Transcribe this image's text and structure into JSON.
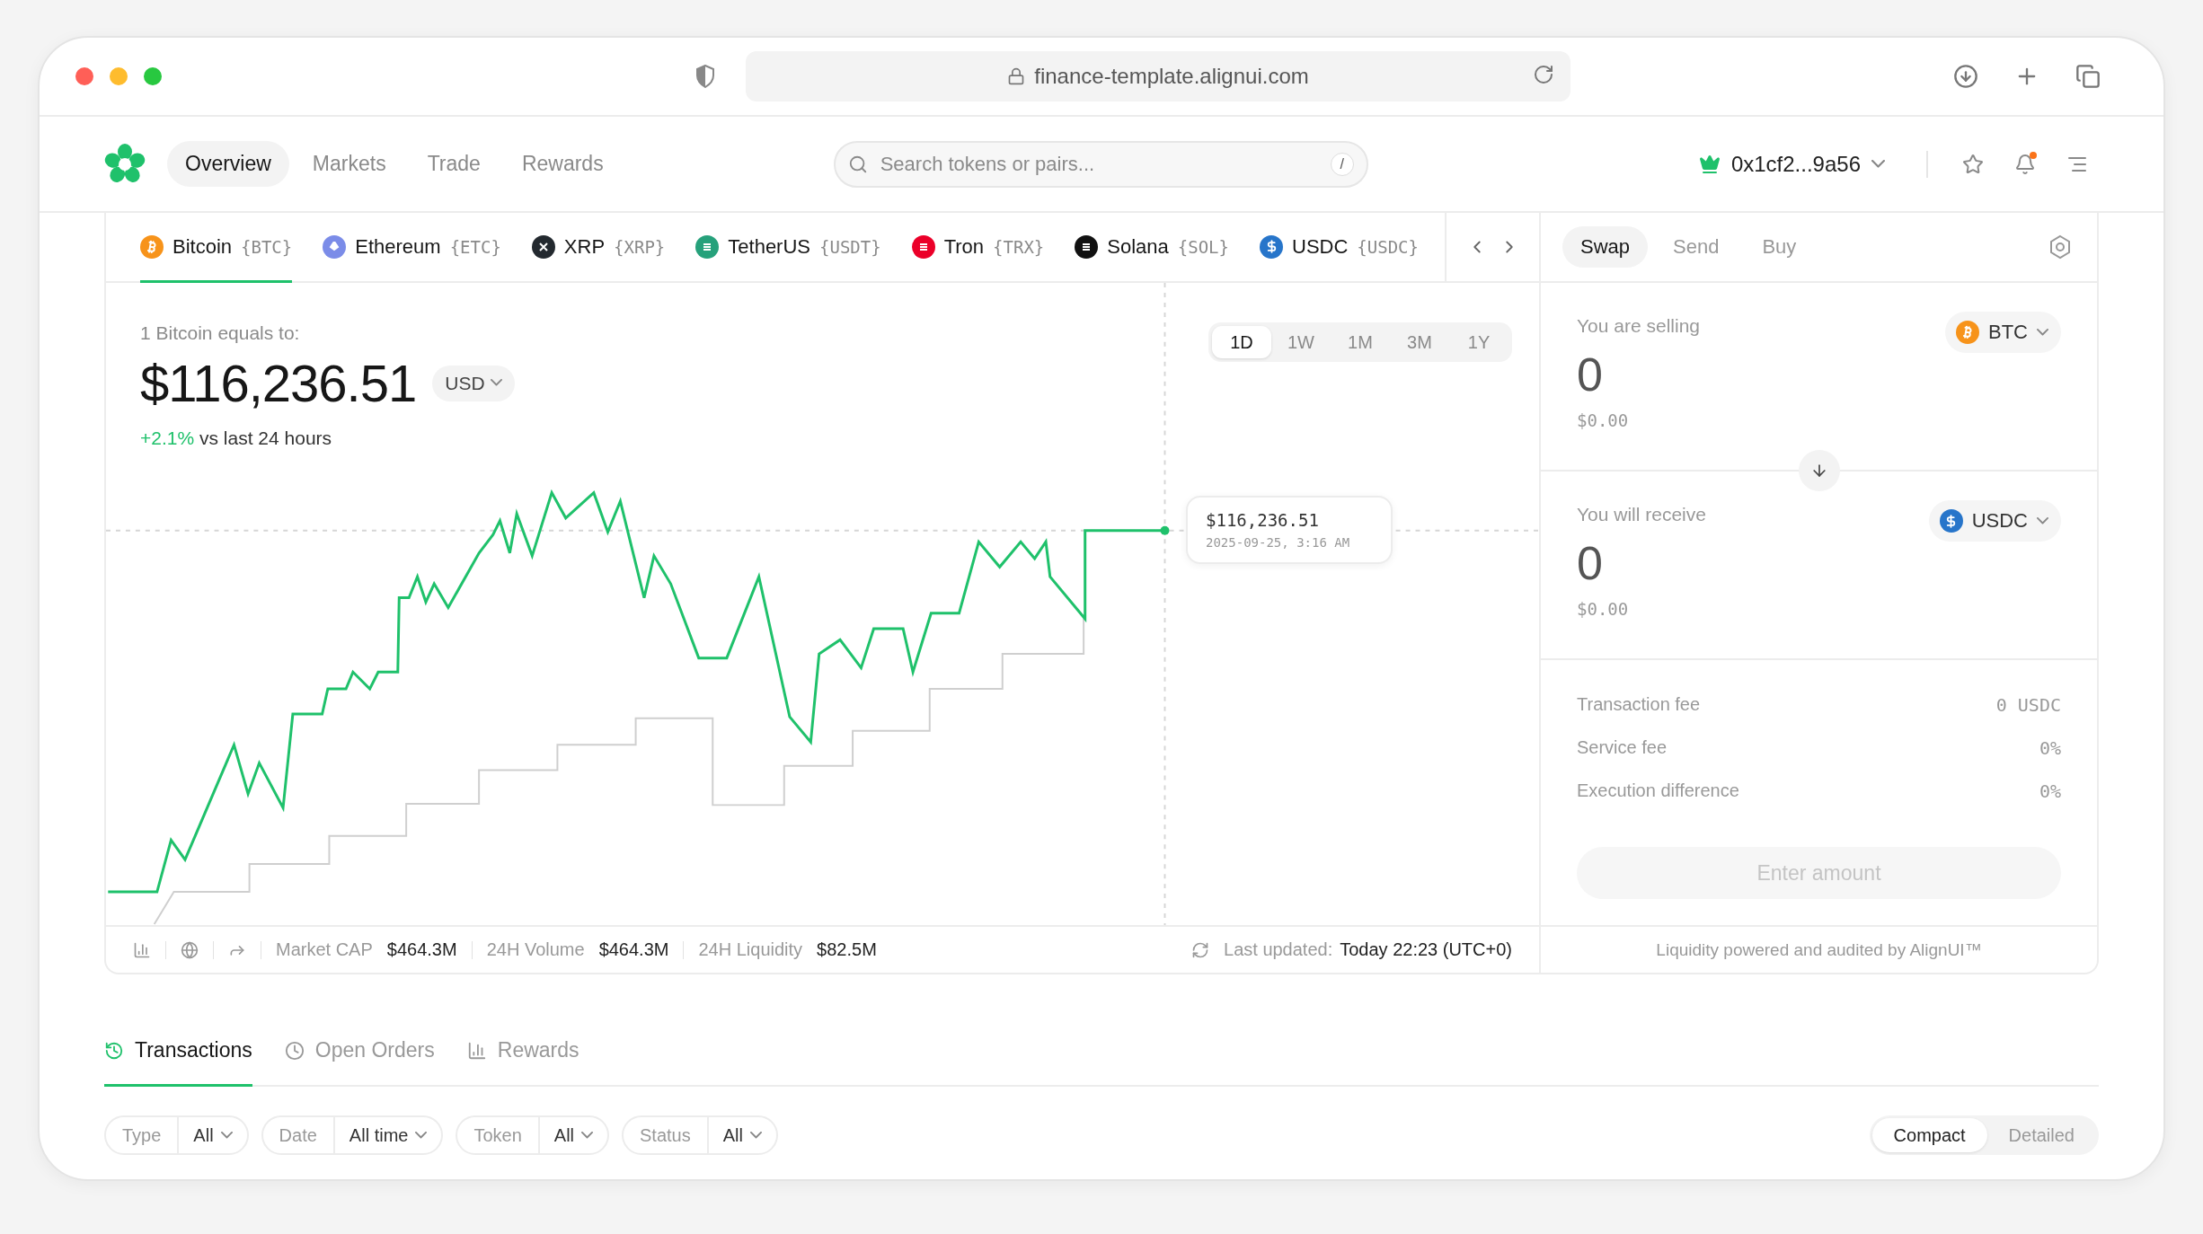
{
  "browser": {
    "url": "finance-template.alignui.com"
  },
  "nav": {
    "items": [
      {
        "label": "Overview",
        "selected": true
      },
      {
        "label": "Markets",
        "selected": false
      },
      {
        "label": "Trade",
        "selected": false
      },
      {
        "label": "Rewards",
        "selected": false
      }
    ],
    "search": {
      "placeholder": "Search tokens or pairs...",
      "shortcut": "/"
    },
    "wallet": "0x1cf2...9a56"
  },
  "tokens": [
    {
      "name": "Bitcoin",
      "symbol": "{BTC}",
      "color": "#f7931a",
      "selected": true
    },
    {
      "name": "Ethereum",
      "symbol": "{ETC}",
      "color": "#7b8ce8",
      "selected": false
    },
    {
      "name": "XRP",
      "symbol": "{XRP}",
      "color": "#23292f",
      "selected": false
    },
    {
      "name": "TetherUS",
      "symbol": "{USDT}",
      "color": "#26a17b",
      "selected": false
    },
    {
      "name": "Tron",
      "symbol": "{TRX}",
      "color": "#eb0029",
      "selected": false
    },
    {
      "name": "Solana",
      "symbol": "{SOL}",
      "color": "#111111",
      "selected": false
    },
    {
      "name": "USDC",
      "symbol": "{USDC}",
      "color": "#2775ca",
      "selected": false
    }
  ],
  "price": {
    "caption": "1 Bitcoin equals to:",
    "value": "$116,236.51",
    "currency": "USD",
    "change": "+2.1%",
    "change_caption": "vs last 24 hours"
  },
  "ranges": [
    {
      "label": "1D",
      "selected": true
    },
    {
      "label": "1W",
      "selected": false
    },
    {
      "label": "1M",
      "selected": false
    },
    {
      "label": "3M",
      "selected": false
    },
    {
      "label": "1Y",
      "selected": false
    }
  ],
  "tooltip": {
    "price": "$116,236.51",
    "time": "2025-09-25, 3:16 AM"
  },
  "stats": [
    {
      "label": "Market CAP",
      "value": "$464.3M"
    },
    {
      "label": "24H Volume",
      "value": "$464.3M"
    },
    {
      "label": "24H Liquidity",
      "value": "$82.5M"
    }
  ],
  "updated": {
    "label": "Last updated:",
    "value": "Today 22:23 (UTC+0)"
  },
  "swap": {
    "tabs": [
      {
        "label": "Swap",
        "selected": true
      },
      {
        "label": "Send",
        "selected": false
      },
      {
        "label": "Buy",
        "selected": false
      }
    ],
    "legs": [
      {
        "label": "You are selling",
        "amount": "0",
        "fiat": "$0.00",
        "token": "BTC",
        "color": "#f7931a"
      },
      {
        "label": "You will receive",
        "amount": "0",
        "fiat": "$0.00",
        "token": "USDC",
        "color": "#2775ca"
      }
    ],
    "fees": [
      {
        "label": "Transaction fee",
        "value": "0 USDC"
      },
      {
        "label": "Service fee",
        "value": "0%"
      },
      {
        "label": "Execution difference",
        "value": "0%"
      }
    ],
    "button": {
      "label": "Enter amount",
      "disabled": true
    },
    "footer": "Liquidity powered and audited by AlignUI™"
  },
  "bottom_tabs": [
    {
      "label": "Transactions",
      "selected": true
    },
    {
      "label": "Open Orders",
      "selected": false
    },
    {
      "label": "Rewards",
      "selected": false
    }
  ],
  "filters": [
    {
      "label": "Type",
      "value": "All"
    },
    {
      "label": "Date",
      "value": "All time"
    },
    {
      "label": "Token",
      "value": "All"
    },
    {
      "label": "Status",
      "value": "All"
    }
  ],
  "views": [
    {
      "label": "Compact",
      "selected": true
    },
    {
      "label": "Detailed",
      "selected": false
    }
  ]
}
